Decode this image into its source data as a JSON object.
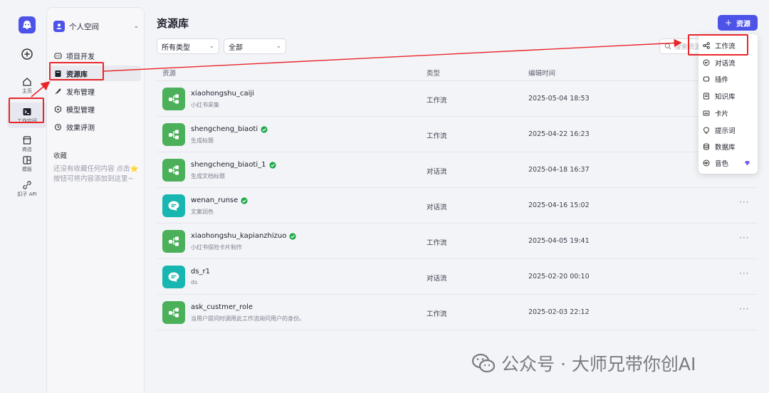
{
  "rail": {
    "items": [
      {
        "label": "主页",
        "icon": "home-icon"
      },
      {
        "label": "工作空间",
        "icon": "workspace-icon",
        "active": true
      },
      {
        "label": "商店",
        "icon": "store-icon"
      },
      {
        "label": "模板",
        "icon": "template-icon"
      },
      {
        "label": "扣子 API",
        "icon": "api-icon"
      }
    ]
  },
  "sidebar": {
    "space_name": "个人空间",
    "nav": [
      {
        "label": "项目开发",
        "icon": "project-icon"
      },
      {
        "label": "资源库",
        "icon": "library-icon",
        "active": true
      },
      {
        "label": "发布管理",
        "icon": "publish-icon"
      },
      {
        "label": "模型管理",
        "icon": "model-icon"
      },
      {
        "label": "效果评测",
        "icon": "evaluate-icon"
      }
    ],
    "favorites_title": "收藏",
    "favorites_hint": "还没有收藏任何内容 点击⭐按钮可将内容添加到这里~"
  },
  "main": {
    "title": "资源库",
    "add_button": "资源",
    "filter_type": "所有类型",
    "filter_scope": "全部",
    "search_placeholder": "搜索资源",
    "columns": {
      "name": "资源",
      "type": "类型",
      "time": "编辑时间"
    }
  },
  "resources": [
    {
      "name": "xiaohongshu_caiji",
      "desc": "小红书采集",
      "type": "工作流",
      "time": "2025-05-04 18:53",
      "kind": "workflow",
      "verified": false
    },
    {
      "name": "shengcheng_biaoti",
      "desc": "生成标题",
      "type": "工作流",
      "time": "2025-04-22 16:23",
      "kind": "workflow",
      "verified": true
    },
    {
      "name": "shengcheng_biaoti_1",
      "desc": "生成文档标题",
      "type": "对话流",
      "time": "2025-04-18 16:37",
      "kind": "workflow",
      "verified": true
    },
    {
      "name": "wenan_runse",
      "desc": "文案润色",
      "type": "对话流",
      "time": "2025-04-16 15:02",
      "kind": "chat",
      "verified": true
    },
    {
      "name": "xiaohongshu_kapianzhizuo",
      "desc": "小红书保险卡片制作",
      "type": "工作流",
      "time": "2025-04-05 19:41",
      "kind": "workflow",
      "verified": true
    },
    {
      "name": "ds_r1",
      "desc": "ds",
      "type": "对话流",
      "time": "2025-02-20 00:10",
      "kind": "chat",
      "verified": false
    },
    {
      "name": "ask_custmer_role",
      "desc": "当用户提问时调用此工作流询问用户的身份。",
      "type": "工作流",
      "time": "2025-02-03 22:12",
      "kind": "workflow",
      "verified": false
    }
  ],
  "menu": {
    "items": [
      {
        "label": "工作流",
        "icon": "workflow-icon"
      },
      {
        "label": "对话流",
        "icon": "chatflow-icon"
      },
      {
        "label": "插件",
        "icon": "plugin-icon"
      },
      {
        "label": "知识库",
        "icon": "knowledge-icon"
      },
      {
        "label": "卡片",
        "icon": "card-icon"
      },
      {
        "label": "提示词",
        "icon": "prompt-icon"
      },
      {
        "label": "数据库",
        "icon": "database-icon"
      },
      {
        "label": "音色",
        "icon": "voice-icon",
        "premium": true
      }
    ]
  },
  "watermark": "公众号 · 大师兄带你创AI",
  "colors": {
    "accent": "#4d53e8",
    "workflow": "#4cb05a",
    "chatflow": "#17b6b0",
    "highlight": "#e8262a",
    "verified": "#1fa84a"
  }
}
